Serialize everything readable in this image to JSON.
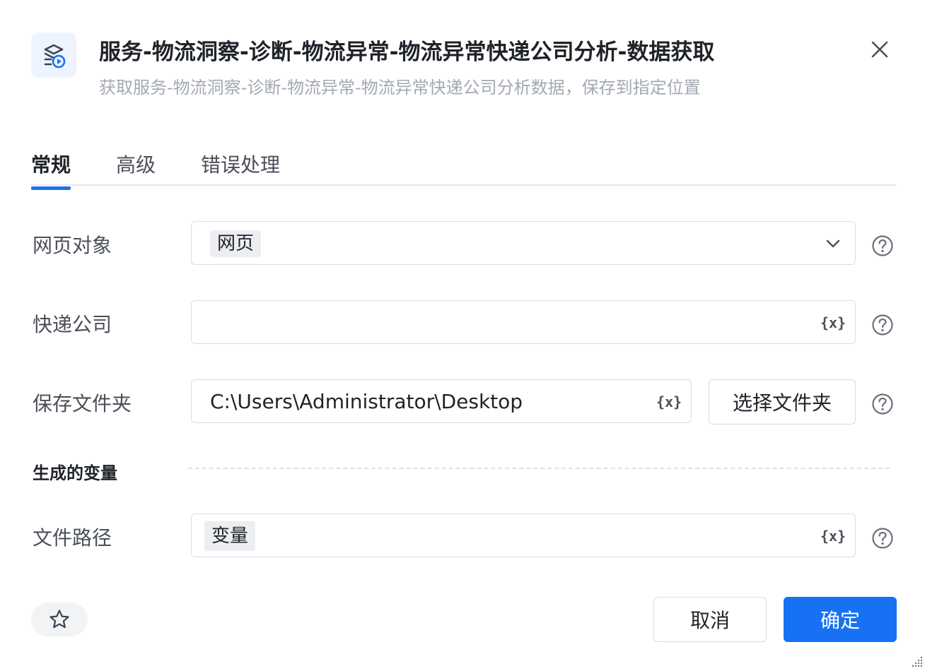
{
  "header": {
    "title": "服务-物流洞察-诊断-物流异常-物流异常快递公司分析-数据获取",
    "subtitle": "获取服务-物流洞察-诊断-物流异常-物流异常快递公司分析数据，保存到指定位置",
    "icon": "app-icon",
    "close_icon": "close-icon"
  },
  "tabs": [
    {
      "label": "常规",
      "active": true
    },
    {
      "label": "高级",
      "active": false
    },
    {
      "label": "错误处理",
      "active": false
    }
  ],
  "form": {
    "web_object": {
      "label": "网页对象",
      "tag": "网页",
      "icon": "chevron-down-icon"
    },
    "courier_company": {
      "label": "快递公司",
      "value": "",
      "var_icon": "{x}"
    },
    "save_folder": {
      "label": "保存文件夹",
      "value": "C:\\Users\\Administrator\\Desktop",
      "var_icon": "{x}",
      "button_label": "选择文件夹"
    },
    "generated_section": {
      "label": "生成的变量"
    },
    "file_path": {
      "label": "文件路径",
      "tag": "变量",
      "var_icon": "{x}"
    }
  },
  "footer": {
    "star_icon": "star-icon",
    "cancel_label": "取消",
    "ok_label": "确定"
  },
  "colors": {
    "primary": "#1672f3",
    "tab_underline": "#1a73e8",
    "icon_bg": "#eef4ff"
  }
}
